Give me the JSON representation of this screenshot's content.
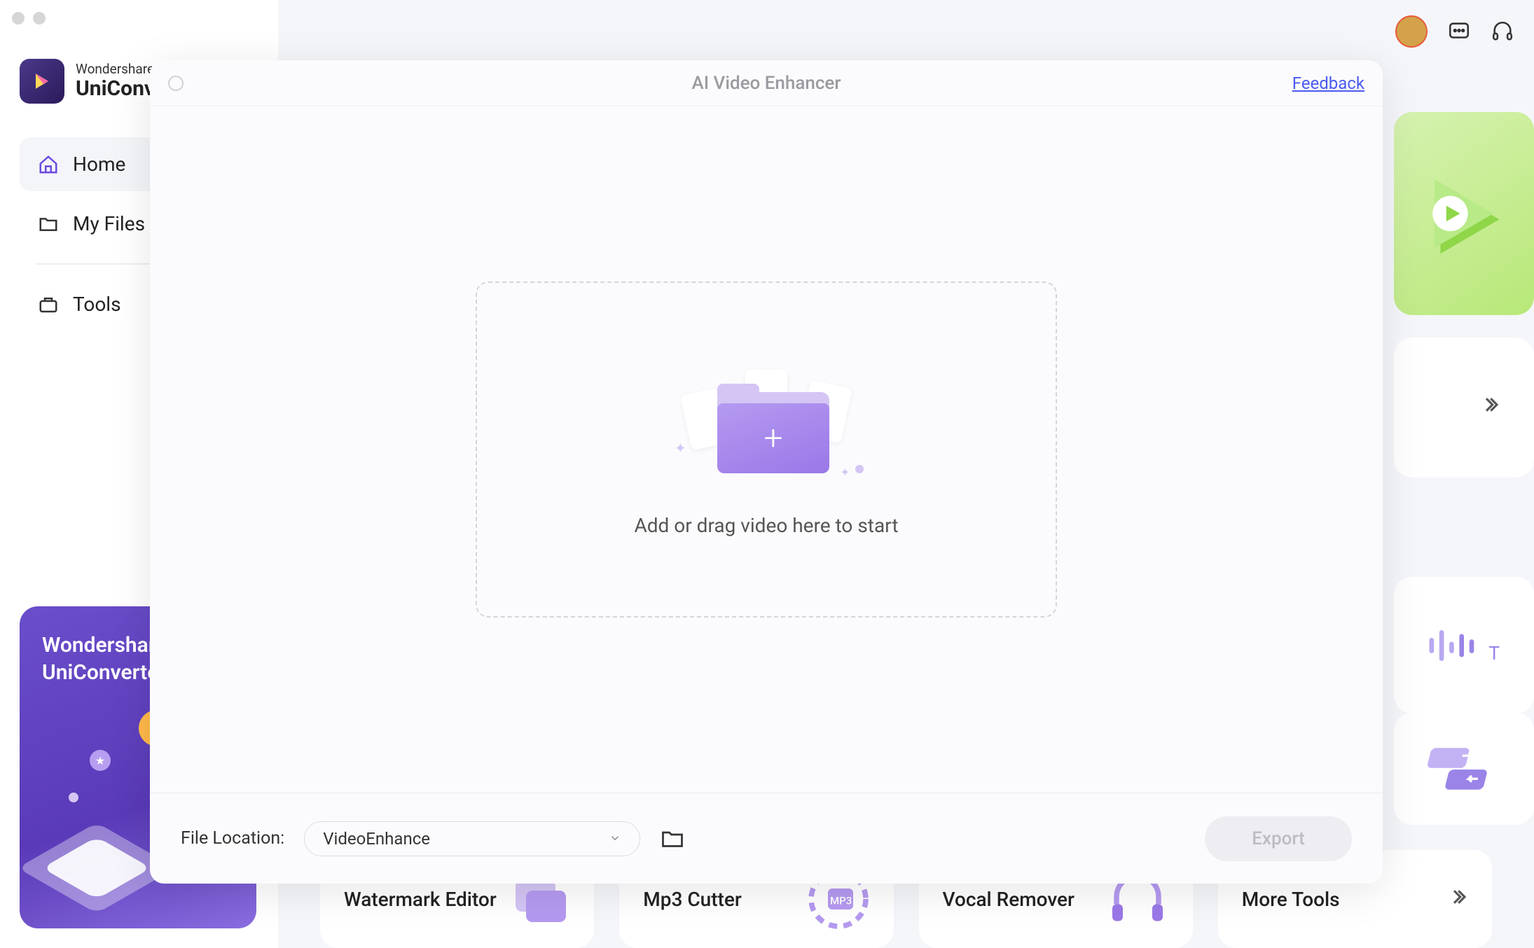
{
  "app": {
    "brand": "Wondershare",
    "product": "UniConverter"
  },
  "sidebar": {
    "items": [
      {
        "label": "Home",
        "active": true
      },
      {
        "label": "My Files",
        "active": false
      },
      {
        "label": "Tools",
        "active": false
      }
    ]
  },
  "promo": {
    "line1": "Wondershare",
    "line2": "UniConverter"
  },
  "background_cards": [
    {
      "label": "Watermark Editor"
    },
    {
      "label": "Mp3 Cutter"
    },
    {
      "label": "Vocal Remover"
    },
    {
      "label": "More Tools"
    }
  ],
  "modal": {
    "title": "AI Video Enhancer",
    "feedback": "Feedback",
    "drop_text": "Add or drag video here to start",
    "footer": {
      "label": "File Location:",
      "location_value": "VideoEnhance",
      "export": "Export"
    }
  }
}
